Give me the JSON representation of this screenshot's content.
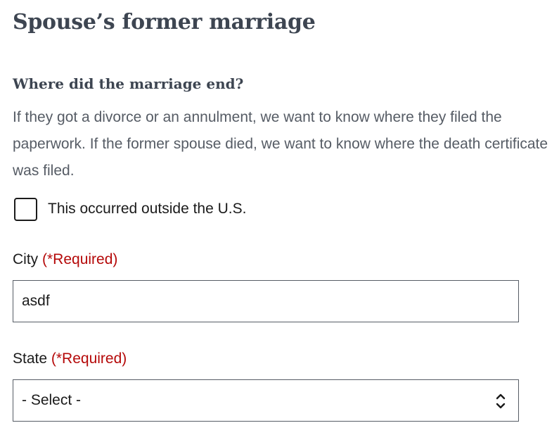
{
  "page": {
    "title": "Spouse’s former marriage"
  },
  "question": {
    "heading": "Where did the marriage end?",
    "hint": "If they got a divorce or an annulment, we want to know where they filed the paperwork. If the former spouse died, we want to know where the death certificate was filed."
  },
  "outside_us": {
    "label": "This occurred outside the U.S.",
    "checked": false
  },
  "city": {
    "label": "City",
    "required": "(*Required)",
    "value": "asdf"
  },
  "state": {
    "label": "State",
    "required": "(*Required)",
    "selected": "- Select -",
    "icon": "chevron-up-down-icon"
  },
  "colors": {
    "heading": "#3d4551",
    "hint": "#565c65",
    "required": "#b50909",
    "border": "#565c65"
  }
}
